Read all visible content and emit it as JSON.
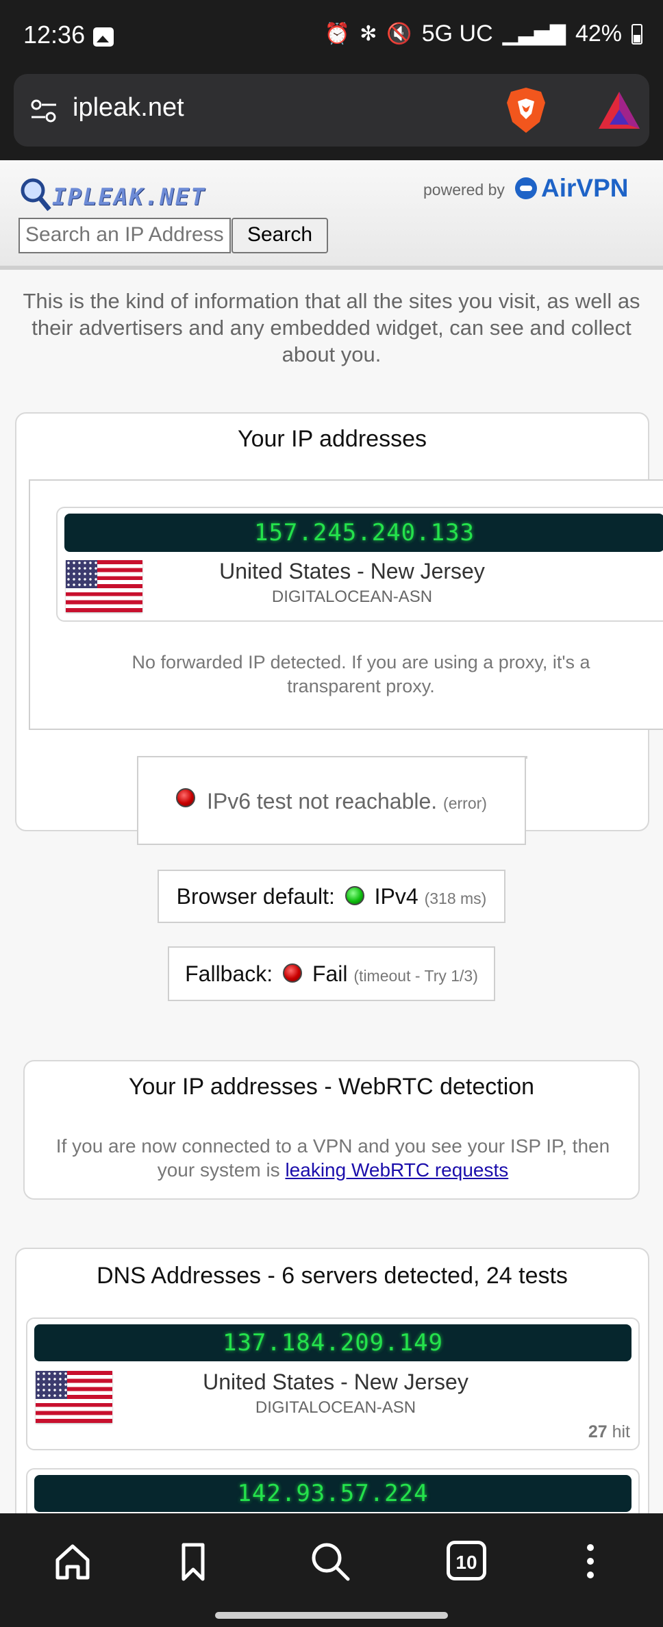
{
  "status_bar": {
    "time": "12:36",
    "network": "5G UC",
    "battery": "42%",
    "icons": [
      "gallery-icon",
      "alarm-icon",
      "bluetooth-icon",
      "mute-icon",
      "signal-icon",
      "battery-icon"
    ]
  },
  "browser": {
    "url": "ipleak.net",
    "tabs_count": "10",
    "icons": [
      "tune-icon",
      "brave-shield-icon",
      "brave-rewards-icon",
      "home-icon",
      "bookmark-icon",
      "search-icon",
      "tabs-icon",
      "more-icon"
    ]
  },
  "header": {
    "logo_text": "IPLEAK.NET",
    "powered_by": "powered by",
    "brand": "AirVPN",
    "search_placeholder": "Search an IP Address",
    "search_button": "Search"
  },
  "intro": "This is the kind of information that all the sites you visit, as well as their advertisers and any embedded widget, can see and collect about you.",
  "ip_section": {
    "title": "Your IP addresses",
    "ip": "157.245.240.133",
    "location": "United States - New Jersey",
    "asn": "DIGITALOCEAN-ASN",
    "forwarded_note": "No forwarded IP detected. If you are using a proxy, it's a transparent proxy.",
    "ipv6_text": "IPv6 test not reachable.",
    "ipv6_detail": "(error)",
    "browser_default_label": "Browser default:",
    "browser_default_value": "IPv4",
    "browser_default_detail": "(318 ms)",
    "fallback_label": "Fallback:",
    "fallback_value": "Fail",
    "fallback_detail": "(timeout - Try 1/3)"
  },
  "webrtc_section": {
    "title": "Your IP addresses - WebRTC detection",
    "text_before": "If you are now connected to a VPN and you see your ISP IP, then your system is",
    "link": "leaking WebRTC requests"
  },
  "dns_section": {
    "title": "DNS Addresses - 6 servers detected, 24 tests",
    "servers": [
      {
        "ip": "137.184.209.149",
        "location": "United States - New Jersey",
        "asn": "DIGITALOCEAN-ASN",
        "hits": "27",
        "hit_label": "hit"
      },
      {
        "ip": "142.93.57.224"
      }
    ]
  },
  "colors": {
    "ip_bar_bg": "#06262d",
    "ip_text": "#24e24c",
    "brand_blue": "#1e63c7",
    "link": "#1a0dab"
  }
}
